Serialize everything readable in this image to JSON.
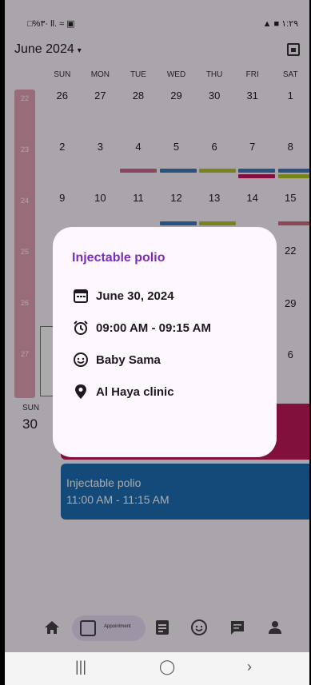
{
  "status_bar": {
    "left": "□%٣· ll. ≈ ▣",
    "right": "▲ ■ ١:٢٩"
  },
  "header": {
    "month": "June 2024"
  },
  "week_days": [
    "SUN",
    "MON",
    "TUE",
    "WED",
    "THU",
    "FRI",
    "SAT"
  ],
  "weeks": [
    {
      "num": "22",
      "days": [
        "26",
        "27",
        "28",
        "29",
        "30",
        "31",
        "1"
      ]
    },
    {
      "num": "23",
      "days": [
        "2",
        "3",
        "4",
        "5",
        "6",
        "7",
        "8"
      ]
    },
    {
      "num": "24",
      "days": [
        "9",
        "10",
        "11",
        "12",
        "13",
        "14",
        "15"
      ]
    },
    {
      "num": "25",
      "days": [
        "",
        "",
        "",
        "",
        "",
        "",
        "22"
      ]
    },
    {
      "num": "26",
      "days": [
        "",
        "",
        "",
        "",
        "",
        "",
        "29"
      ]
    },
    {
      "num": "27",
      "days": [
        "",
        "",
        "",
        "",
        "",
        "",
        "6"
      ]
    }
  ],
  "day_view": {
    "weekday": "SUN",
    "date": "30"
  },
  "events": [
    {
      "title": "Injectable polio",
      "time": "11:00 AM - 11:15 AM",
      "color": "#1e6fb6"
    }
  ],
  "dialog": {
    "title": "Injectable polio",
    "date": "June 30, 2024",
    "time": "09:00 AM - 09:15 AM",
    "patient": "Baby Sama",
    "location": "Al Haya clinic"
  },
  "nav": {
    "active_label": "Appointment"
  },
  "colors": {
    "accent": "#7b2cbf",
    "event_red": "#c2185b",
    "event_blue": "#1e6fb6",
    "week_rail": "#e3a2b5"
  }
}
